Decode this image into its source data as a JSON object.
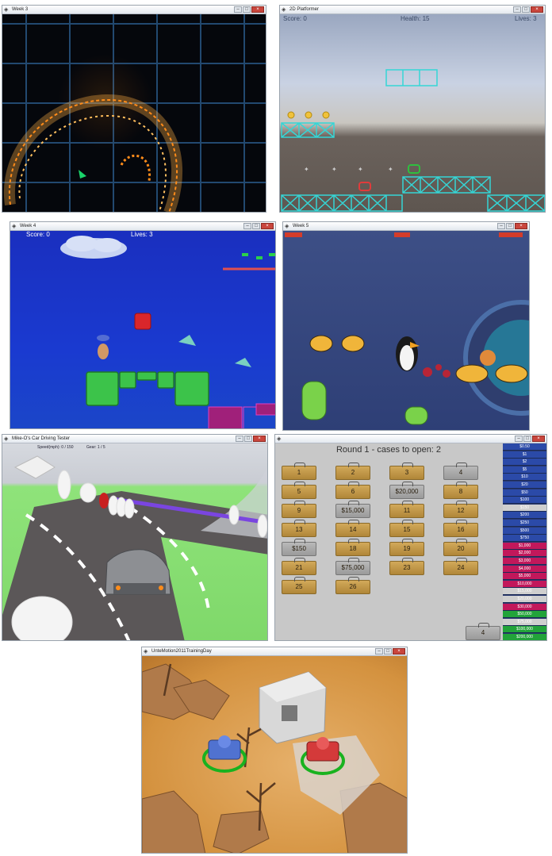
{
  "windows": {
    "w1": {
      "title": "Week 3"
    },
    "w2": {
      "title": "2D Platformer",
      "score": "Score: 0",
      "health": "Health: 15",
      "lives": "Lives: 3"
    },
    "w3": {
      "title": "Week 4",
      "score": "Score: 0",
      "lives": "Lives: 3"
    },
    "w4": {
      "title": "Week 5"
    },
    "w5": {
      "title": "Mike-O's Car Driving Tester",
      "speed": "Speed(mph): 0 / 150",
      "gear": "Gear: 1 / 5"
    },
    "w6": {
      "title": "",
      "round_text": "Round 1 - cases to open: 2",
      "cases": [
        "1",
        "2",
        "3",
        "4",
        "5",
        "6",
        "$20,000",
        "8",
        "9",
        "$15,000",
        "11",
        "12",
        "13",
        "14",
        "15",
        "16",
        "$150",
        "18",
        "19",
        "20",
        "21",
        "$75,000",
        "23",
        "24",
        "25",
        "26"
      ],
      "opened_cases": [
        "4",
        "$20,000",
        "$15,000",
        "$150",
        "$75,000"
      ],
      "player_case": "4",
      "money_values": [
        "$0.50",
        "$1",
        "$2",
        "$5",
        "$10",
        "$20",
        "$50",
        "$100",
        "$150",
        "$200",
        "$250",
        "$500",
        "$750",
        "$1,000",
        "$2,000",
        "$3,000",
        "$4,000",
        "$5,000",
        "$10,000",
        "$15,000",
        "$20,000",
        "$30,000",
        "$50,000",
        "$75,000",
        "$100,000",
        "$200,000"
      ],
      "colors": {
        "low": "#2b4aa8",
        "high": "#c2185b",
        "eliminated": "#cfcfcf",
        "top": "#22a33a"
      }
    },
    "w7": {
      "title": "UnteMotion2011TrainingDay"
    }
  },
  "window_controls": {
    "minimize": "–",
    "maximize": "□",
    "close": "×"
  },
  "icons": {
    "app": "unity-icon"
  }
}
